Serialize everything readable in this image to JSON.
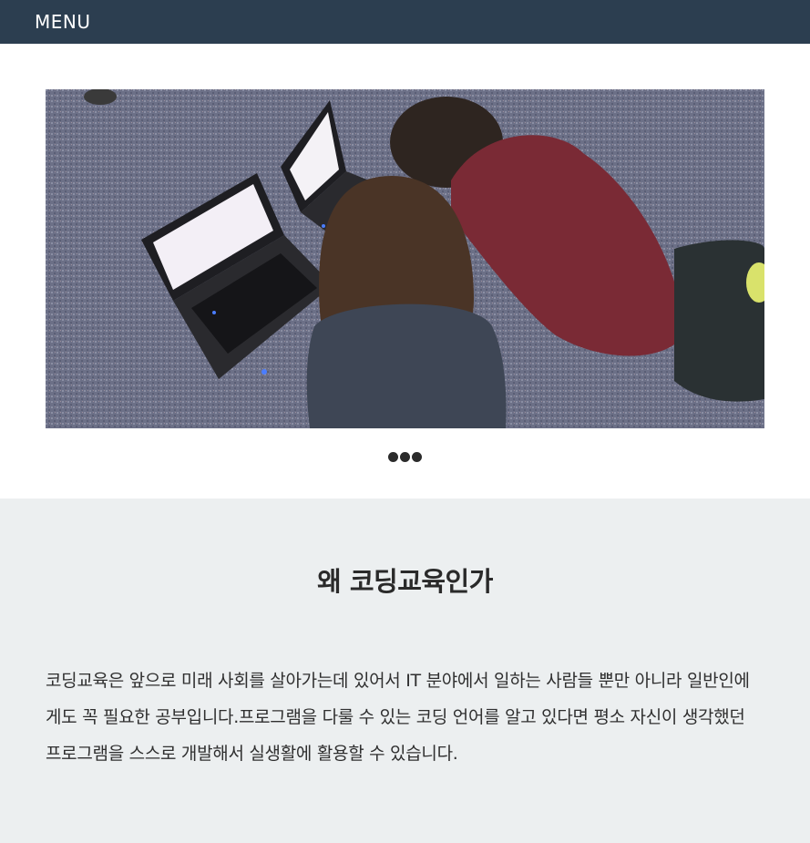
{
  "navbar": {
    "menu_label": "MENU"
  },
  "hero": {
    "image_description_icon": "photo-kids-laptops",
    "carousel_dots": 3
  },
  "section": {
    "title": "왜 코딩교육인가",
    "body": "코딩교육은 앞으로 미래 사회를 살아가는데 있어서 IT 분야에서 일하는 사람들 뿐만 아니라 일반인에게도 꼭 필요한 공부입니다.프로그램을 다룰 수 있는 코딩 언어를 알고 있다면 평소 자신이 생각했던 프로그램을 스스로 개발해서 실생활에 활용할 수 있습니다."
  },
  "colors": {
    "navbar_bg": "#2c3e50",
    "section_bg": "#eceff0",
    "dot": "#2b2b2b"
  }
}
